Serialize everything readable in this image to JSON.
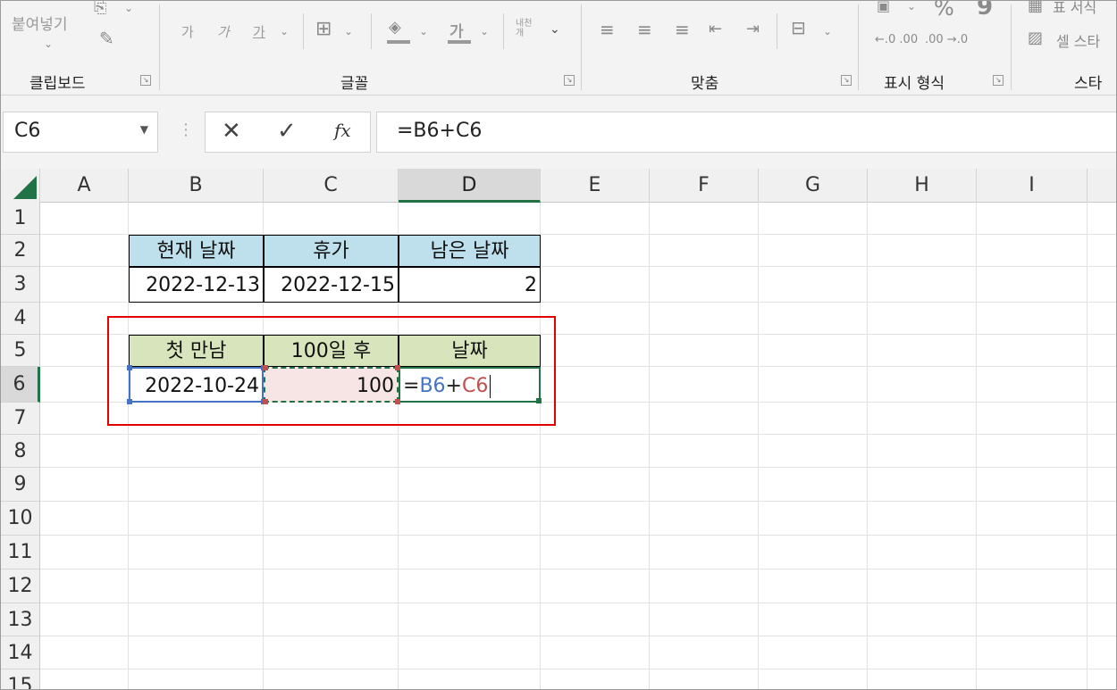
{
  "ribbon": {
    "clipboard": {
      "paste_label": "붙여넣기",
      "group_label": "클립보드"
    },
    "font": {
      "bold_label": "가",
      "italic_label": "가",
      "underline_label": "가",
      "font_color_label": "가",
      "wrap_label": "내천\n개",
      "group_label": "글꼴"
    },
    "alignment": {
      "group_label": "맞춤"
    },
    "number": {
      "percent_label": "%",
      "comma_label": "9",
      "group_label": "표시 형식"
    },
    "styles": {
      "table_format_label": "표 서식",
      "cell_style_label": "셀 스타",
      "group_label": "스타"
    }
  },
  "formula_bar": {
    "name_box": "C6",
    "fx_label": "fx",
    "formula": "=B6+C6"
  },
  "columns": [
    "A",
    "B",
    "C",
    "D",
    "E",
    "F",
    "G",
    "H",
    "I"
  ],
  "selected_column": "D",
  "rows": [
    "1",
    "2",
    "3",
    "4",
    "5",
    "6",
    "7",
    "8",
    "9",
    "10",
    "11",
    "12",
    "13",
    "14",
    "15"
  ],
  "selected_row": "6",
  "table1": {
    "headers": [
      "현재 날짜",
      "휴가",
      "남은 날짜"
    ],
    "values": [
      "2022-12-13",
      "2022-12-15",
      "2"
    ]
  },
  "table2": {
    "headers": [
      "첫 만남",
      "100일 후",
      "날짜"
    ],
    "values": [
      "2022-10-24",
      "100"
    ],
    "formula": {
      "eq": "=",
      "ref1": "B6",
      "plus": "+",
      "ref2": "C6"
    }
  },
  "colors": {
    "accent": "#217346",
    "blue_header": "#bde0ec",
    "green_header": "#d8e4bc",
    "highlight": "#e00000",
    "ref1": "#4472c4",
    "ref2": "#c0504d"
  }
}
